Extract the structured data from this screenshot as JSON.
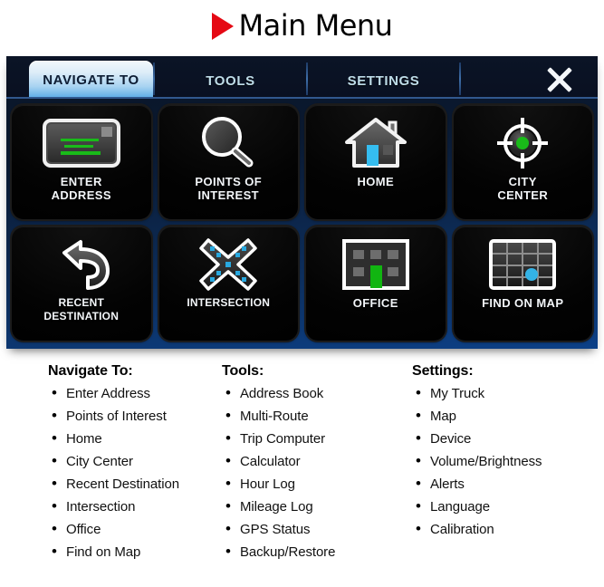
{
  "page": {
    "title": "Main Menu",
    "title_arrow_color": "#e50914"
  },
  "device": {
    "tabs": [
      {
        "label": "NAVIGATE TO",
        "active": true
      },
      {
        "label": "TOOLS",
        "active": false
      },
      {
        "label": "SETTINGS",
        "active": false
      }
    ],
    "close_icon": "close-icon",
    "tiles": [
      {
        "label_line1": "ENTER",
        "label_line2": "ADDRESS",
        "icon": "keyboard-screen-icon"
      },
      {
        "label_line1": "POINTS OF",
        "label_line2": "INTEREST",
        "icon": "magnifier-icon"
      },
      {
        "label_line1": "HOME",
        "label_line2": "",
        "icon": "house-icon"
      },
      {
        "label_line1": "CITY",
        "label_line2": "CENTER",
        "icon": "crosshair-icon"
      },
      {
        "label_line1": "RECENT",
        "label_line2": "DESTINATION",
        "icon": "u-turn-arrow-icon"
      },
      {
        "label_line1": "INTERSECTION",
        "label_line2": "",
        "icon": "intersection-cross-icon"
      },
      {
        "label_line1": "OFFICE",
        "label_line2": "",
        "icon": "office-building-icon"
      },
      {
        "label_line1": "FIND ON MAP",
        "label_line2": "",
        "icon": "map-grid-icon"
      }
    ]
  },
  "lists": [
    {
      "heading": "Navigate To:",
      "items": [
        "Enter Address",
        "Points of Interest",
        "Home",
        "City Center",
        "Recent Destination",
        "Intersection",
        "Office",
        "Find on Map"
      ]
    },
    {
      "heading": "Tools:",
      "items": [
        "Address Book",
        "Multi-Route",
        "Trip Computer",
        "Calculator",
        "Hour Log",
        "Mileage Log",
        "GPS Status",
        "Backup/Restore"
      ]
    },
    {
      "heading": "Settings:",
      "items": [
        "My Truck",
        "Map",
        "Device",
        "Volume/Brightness",
        "Alerts",
        "Language",
        "Calibration"
      ]
    }
  ],
  "colors": {
    "title_arrow": "#e50914",
    "panel_blue": "#0c4087",
    "tab_active_text": "#0d1c33",
    "tab_inactive_text": "#bfdde9",
    "accent_green": "#19bb19",
    "accent_blue": "#3cb4e8"
  }
}
